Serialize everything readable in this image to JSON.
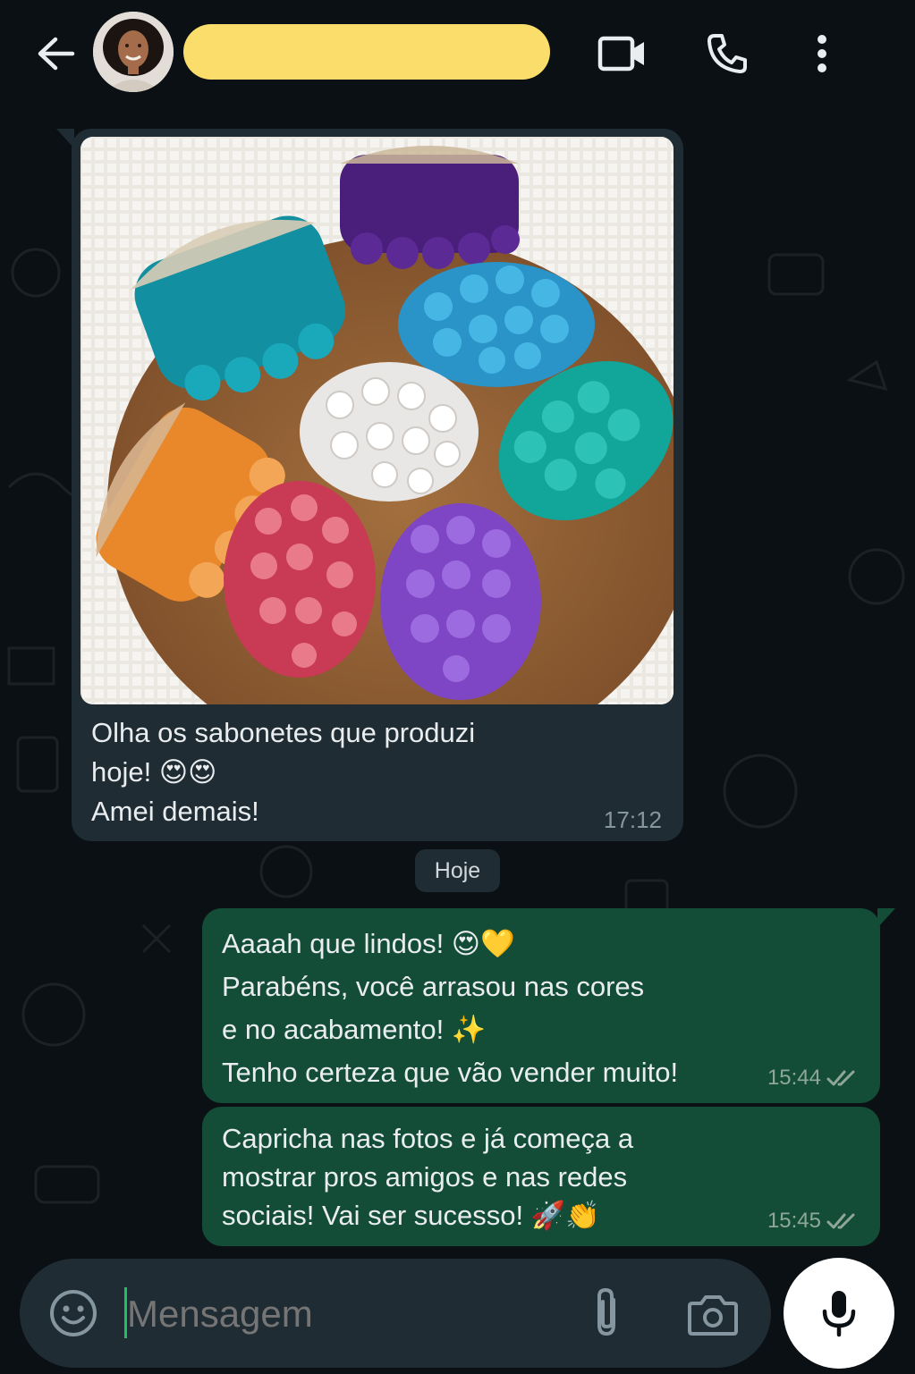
{
  "header": {
    "back_icon": "arrow-left-icon",
    "contact_name": "",
    "name_redaction_color": "#fbdd6c",
    "actions": [
      "video-call-icon",
      "voice-call-icon",
      "more-options-icon"
    ]
  },
  "messages": [
    {
      "direction": "incoming",
      "has_image": true,
      "image_description": "colorful massage soap bars with loofah on a wooden board",
      "lines": [
        "Olha os sabonetes que produzi",
        "hoje! 😍😍",
        "Amei demais!"
      ],
      "time": "17:12"
    },
    {
      "direction": "outgoing",
      "lines": [
        "Aaaah que lindos! 😍💛",
        "Parabéns, você arrasou nas cores",
        "e no acabamento! ✨",
        "Tenho certeza que vão vender muito!"
      ],
      "time": "15:44",
      "status": "read"
    },
    {
      "direction": "outgoing",
      "lines": [
        "Capricha nas fotos e já começa a",
        "mostrar pros amigos e nas redes",
        "sociais! Vai ser sucesso! 🚀👏"
      ],
      "time": "15:45",
      "status": "read"
    }
  ],
  "day_divider": "Hoje",
  "composer": {
    "placeholder": "Mensagem",
    "value": "",
    "icons": [
      "emoji-icon",
      "attach-icon",
      "camera-icon",
      "mic-icon"
    ]
  },
  "colors": {
    "background": "#0b1014",
    "incoming_bubble": "#1f2c33",
    "outgoing_bubble": "#144d37",
    "accent": "#21c063"
  }
}
